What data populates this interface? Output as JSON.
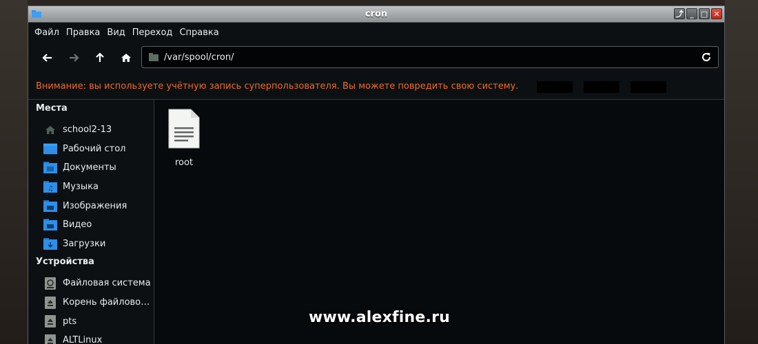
{
  "window": {
    "title": "cron",
    "wm_buttons": [
      "⤴",
      "_",
      "□",
      "✕"
    ]
  },
  "menubar": {
    "items": [
      "Файл",
      "Правка",
      "Вид",
      "Переход",
      "Справка"
    ]
  },
  "toolbar": {
    "back_icon": "arrow-left-icon",
    "forward_icon": "arrow-right-icon",
    "up_icon": "arrow-up-icon",
    "home_icon": "home-icon",
    "location_path": "/var/spool/cron/",
    "reload_icon": "reload-icon"
  },
  "warning": {
    "text": "Внимание: вы используете учётную запись суперпользователя. Вы можете повредить свою систему."
  },
  "sidebar": {
    "places_title": "Места",
    "places": [
      {
        "label": "school2-13",
        "icon": "home-icon"
      },
      {
        "label": "Рабочий стол",
        "icon": "desktop-folder-icon"
      },
      {
        "label": "Документы",
        "icon": "documents-folder-icon"
      },
      {
        "label": "Музыка",
        "icon": "music-folder-icon"
      },
      {
        "label": "Изображения",
        "icon": "pictures-folder-icon"
      },
      {
        "label": "Видео",
        "icon": "videos-folder-icon"
      },
      {
        "label": "Загрузки",
        "icon": "downloads-folder-icon"
      }
    ],
    "devices_title": "Устройства",
    "devices": [
      {
        "label": "Файловая система",
        "icon": "filesystem-icon"
      },
      {
        "label": "Корень файловой…",
        "icon": "eject-drive-icon"
      },
      {
        "label": "pts",
        "icon": "eject-drive-icon"
      },
      {
        "label": "ALTLinux",
        "icon": "eject-drive-icon"
      }
    ]
  },
  "files": [
    {
      "name": "root",
      "icon": "text-file-icon"
    }
  ],
  "watermark": "www.alexfine.ru",
  "colors": {
    "warning": "#f06a22",
    "folder_blue": "#2e8fe8",
    "close_red": "#e0362a"
  }
}
